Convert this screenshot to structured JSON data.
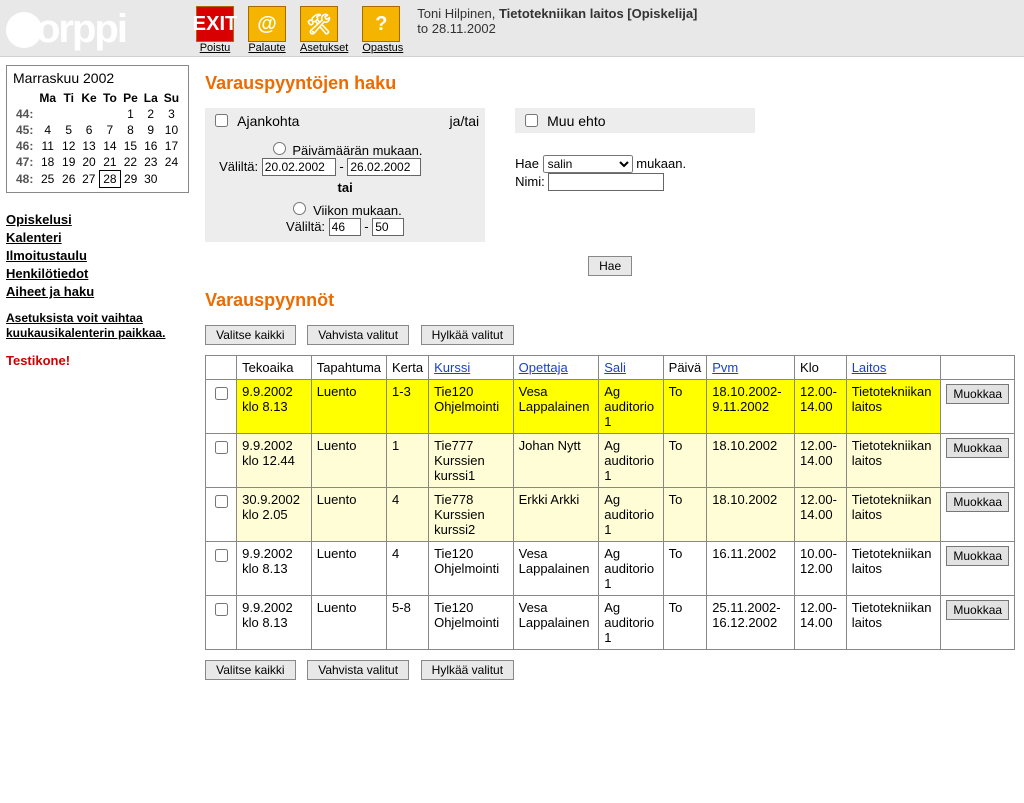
{
  "header": {
    "user": "Toni Hilpinen",
    "department": "Tietotekniikan laitos [Opiskelija]",
    "date": "to 28.11.2002",
    "toolbar": {
      "exit": {
        "icon": "EXIT",
        "label": "Poistu"
      },
      "feedback": {
        "icon": "@",
        "label": "Palaute"
      },
      "settings": {
        "icon": "✖",
        "label": "Asetukset"
      },
      "help": {
        "icon": "?",
        "label": "Opastus"
      }
    }
  },
  "calendar": {
    "title": "Marraskuu 2002",
    "days": [
      "Ma",
      "Ti",
      "Ke",
      "To",
      "Pe",
      "La",
      "Su"
    ],
    "weeks": [
      {
        "wk": "44:",
        "d": [
          "",
          "",
          "",
          "",
          "1",
          "2",
          "3"
        ]
      },
      {
        "wk": "45:",
        "d": [
          "4",
          "5",
          "6",
          "7",
          "8",
          "9",
          "10"
        ]
      },
      {
        "wk": "46:",
        "d": [
          "11",
          "12",
          "13",
          "14",
          "15",
          "16",
          "17"
        ]
      },
      {
        "wk": "47:",
        "d": [
          "18",
          "19",
          "20",
          "21",
          "22",
          "23",
          "24"
        ]
      },
      {
        "wk": "48:",
        "d": [
          "25",
          "26",
          "27",
          "28",
          "29",
          "30",
          ""
        ]
      }
    ],
    "today": "28"
  },
  "nav": {
    "opiskelusi": "Opiskelusi",
    "kalenteri": "Kalenteri",
    "ilmoitus": "Ilmoitustaulu",
    "henkilo": "Henkilötiedot",
    "aiheet": "Aiheet ja haku",
    "hint": "Asetuksista voit vaihtaa kuukausikalenterin paikkaa.",
    "test": "Testikone!"
  },
  "search": {
    "title": "Varauspyyntöjen haku",
    "ajankohta": "Ajankohta",
    "jatai": "ja/tai",
    "muu": "Muu ehto",
    "paiva": "Päivämäärän mukaan.",
    "valilta": "Väliltä:",
    "date_from": "20.02.2002",
    "date_to": "26.02.2002",
    "tai": "tai",
    "viikko": "Viikon mukaan.",
    "wk_from": "46",
    "wk_to": "50",
    "hae": "Hae",
    "mukaan": "mukaan.",
    "sel_options": [
      "salin"
    ],
    "sel_value": "salin",
    "nimi": "Nimi:",
    "nimi_value": "",
    "hae_btn": "Hae"
  },
  "requests": {
    "title": "Varauspyynnöt",
    "btn_all": "Valitse kaikki",
    "btn_confirm": "Vahvista valitut",
    "btn_reject": "Hylkää valitut",
    "headers": {
      "tekoaika": "Tekoaika",
      "tapahtuma": "Tapahtuma",
      "kerta": "Kerta",
      "kurssi": "Kurssi",
      "opettaja": "Opettaja",
      "sali": "Sali",
      "paiva": "Päivä",
      "pvm": "Pvm",
      "klo": "Klo",
      "laitos": "Laitos"
    },
    "edit": "Muokkaa",
    "rows": [
      {
        "hl": true,
        "teko": "9.9.2002 klo 8.13",
        "tap": "Luento",
        "kerta": "1-3",
        "kurssi": "Tie120 Ohjelmointi",
        "op": "Vesa Lappalainen",
        "sali": "Ag auditorio 1",
        "pv": "To",
        "pvm": "18.10.2002-9.11.2002",
        "klo": "12.00-14.00",
        "laitos": "Tietotekniikan laitos"
      },
      {
        "soft": true,
        "teko": "9.9.2002 klo 12.44",
        "tap": "Luento",
        "kerta": "1",
        "kurssi": "Tie777 Kurssien kurssi1",
        "op": "Johan Nytt",
        "sali": "Ag auditorio 1",
        "pv": "To",
        "pvm": "18.10.2002",
        "klo": "12.00-14.00",
        "laitos": "Tietotekniikan laitos"
      },
      {
        "soft": true,
        "teko": "30.9.2002 klo 2.05",
        "tap": "Luento",
        "kerta": "4",
        "kurssi": "Tie778 Kurssien kurssi2",
        "op": "Erkki Arkki",
        "sali": "Ag auditorio 1",
        "pv": "To",
        "pvm": "18.10.2002",
        "klo": "12.00-14.00",
        "laitos": "Tietotekniikan laitos"
      },
      {
        "teko": "9.9.2002 klo 8.13",
        "tap": "Luento",
        "kerta": "4",
        "kurssi": "Tie120 Ohjelmointi",
        "op": "Vesa Lappalainen",
        "sali": "Ag auditorio 1",
        "pv": "To",
        "pvm": "16.11.2002",
        "klo": "10.00-12.00",
        "laitos": "Tietotekniikan laitos"
      },
      {
        "teko": "9.9.2002 klo 8.13",
        "tap": "Luento",
        "kerta": "5-8",
        "kurssi": "Tie120 Ohjelmointi",
        "op": "Vesa Lappalainen",
        "sali": "Ag auditorio 1",
        "pv": "To",
        "pvm": "25.11.2002-16.12.2002",
        "klo": "12.00-14.00",
        "laitos": "Tietotekniikan laitos"
      }
    ]
  }
}
